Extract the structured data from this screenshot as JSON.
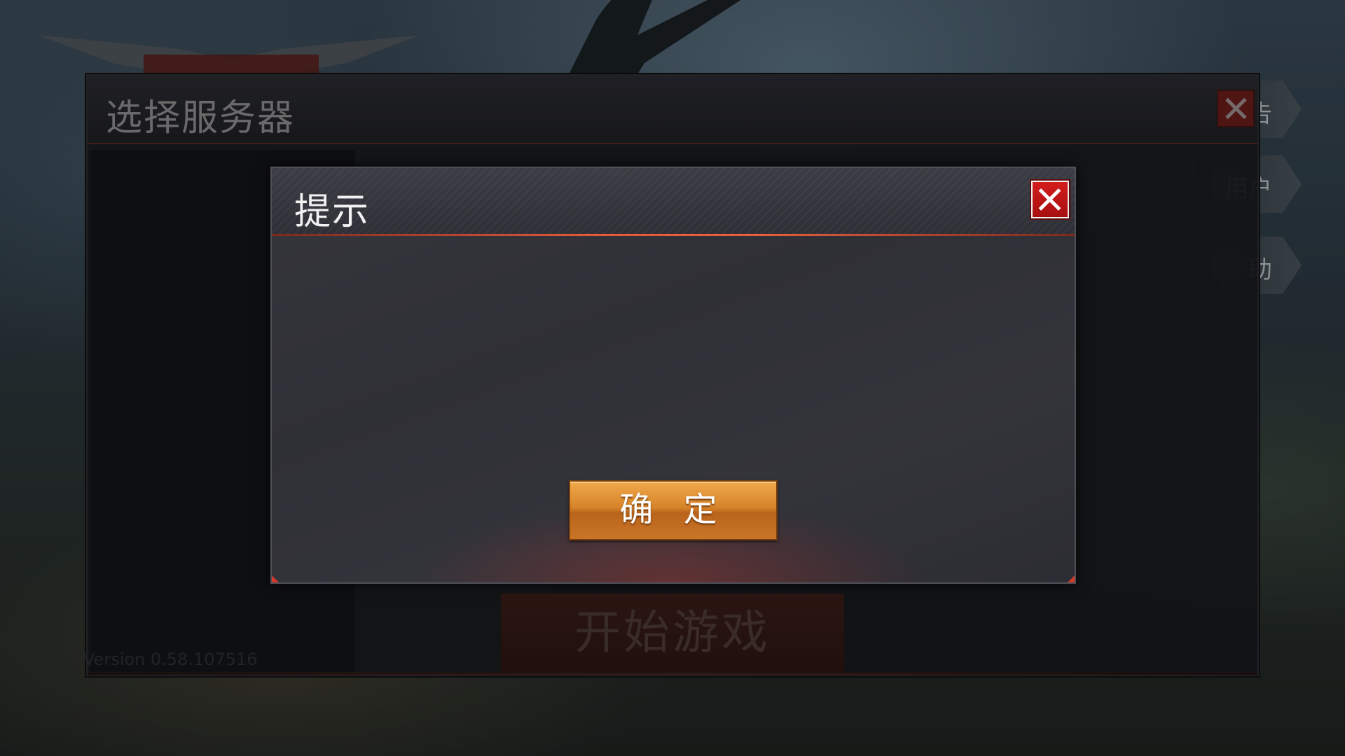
{
  "server_panel": {
    "title": "选择服务器",
    "start_button": "开始游戏",
    "version": "Version 0.58.107516"
  },
  "side_menu": {
    "items": [
      "告",
      "用户",
      "助"
    ]
  },
  "dialog": {
    "title": "提示",
    "message": "",
    "confirm_label": "确 定"
  },
  "colors": {
    "accent_red": "#d41d1d",
    "confirm_orange": "#d7842a",
    "header_line": "#e25a3c"
  }
}
